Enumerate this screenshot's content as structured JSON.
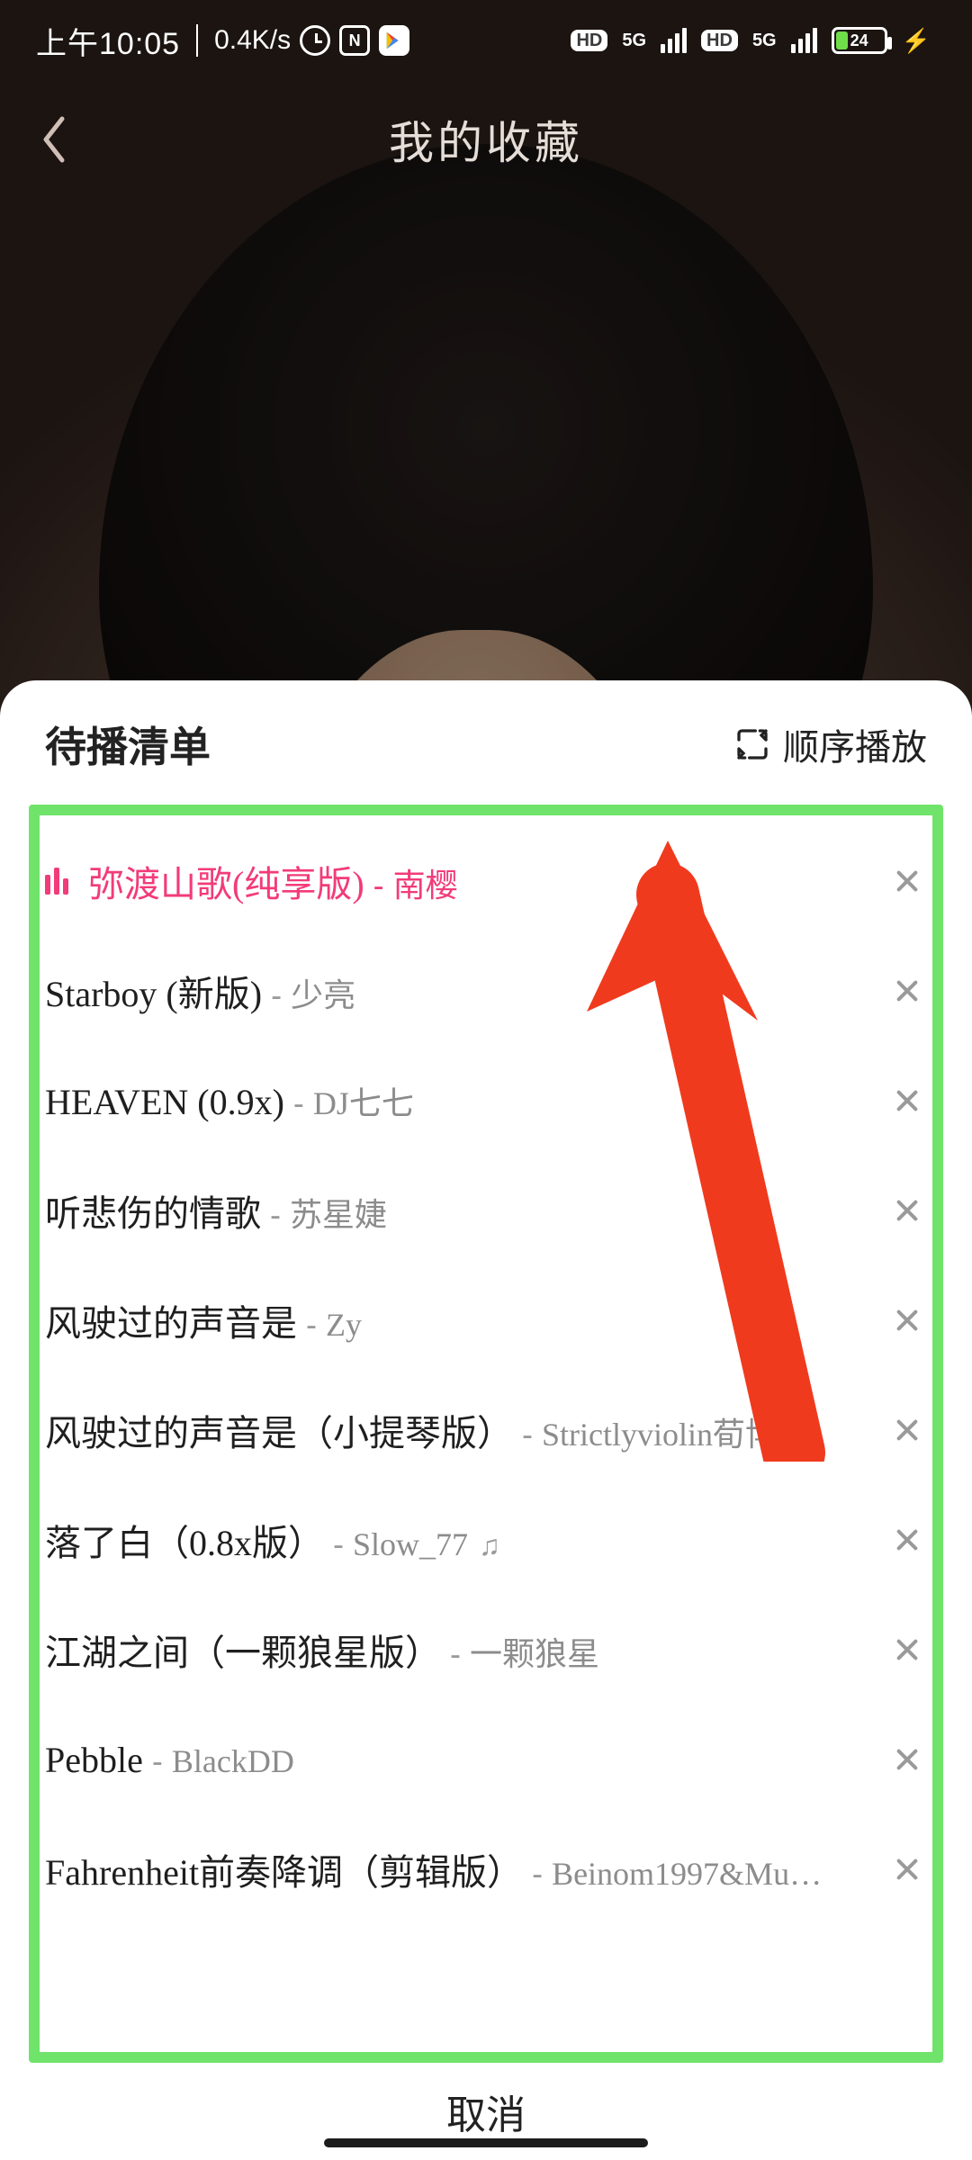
{
  "status": {
    "clock": "上午10:05",
    "net_speed": "0.4K/s",
    "battery_pct": "24",
    "sig_label": "5G"
  },
  "header": {
    "title": "我的收藏"
  },
  "sheet": {
    "title": "待播清单",
    "mode_label": "顺序播放",
    "cancel": "取消"
  },
  "songs": [
    {
      "title": "弥渡山歌(纯享版)",
      "artist": "南樱",
      "playing": true
    },
    {
      "title": "Starboy (新版)",
      "artist": "少亮"
    },
    {
      "title": "HEAVEN (0.9x)",
      "artist": "DJ七七"
    },
    {
      "title": "听悲伤的情歌",
      "artist": "苏星婕"
    },
    {
      "title": "风驶过的声音是",
      "artist": "Zy"
    },
    {
      "title": "风驶过的声音是（小提琴版）",
      "artist": "Strictlyviolin荀博…"
    },
    {
      "title": "落了白（0.8x版）",
      "artist": "Slow_77",
      "note": true
    },
    {
      "title": "江湖之间（一颗狼星版）",
      "artist": "一颗狼星"
    },
    {
      "title": "Pebble",
      "artist": "BlackDD"
    },
    {
      "title": "Fahrenheit前奏降调（剪辑版）",
      "artist": "Beinom1997&Mu…"
    }
  ],
  "annotation": {
    "type": "swipe-up-arrow"
  }
}
